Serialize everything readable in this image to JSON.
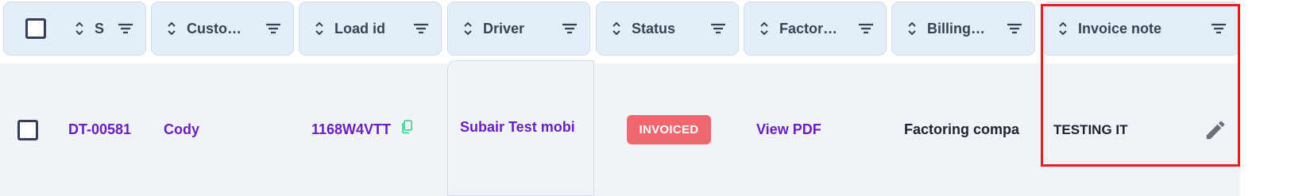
{
  "columns": [
    {
      "label": "S"
    },
    {
      "label": "Custo…"
    },
    {
      "label": "Load id"
    },
    {
      "label": "Driver"
    },
    {
      "label": "Status"
    },
    {
      "label": "Factor…"
    },
    {
      "label": "Billing…"
    },
    {
      "label": "Invoice note"
    }
  ],
  "row": {
    "invoice_id": "DT-00581",
    "customer": "Cody",
    "load_id": "1168W4VTT",
    "driver": "Subair Test  mobi",
    "status": "INVOICED",
    "factoring": "View PDF",
    "billing": "Factoring compa",
    "invoice_note": "TESTING IT"
  },
  "colors": {
    "header_bg": "#e4eef8",
    "body_bg": "#f0f3f7",
    "link": "#6a1fc0",
    "badge": "#f0686f",
    "copy_icon": "#2fd08a",
    "highlight": "#e0221c"
  },
  "icons": {
    "sort": "sort-updown-icon",
    "filter": "filter-lines-icon",
    "copy": "copy-icon",
    "edit": "pencil-icon"
  }
}
